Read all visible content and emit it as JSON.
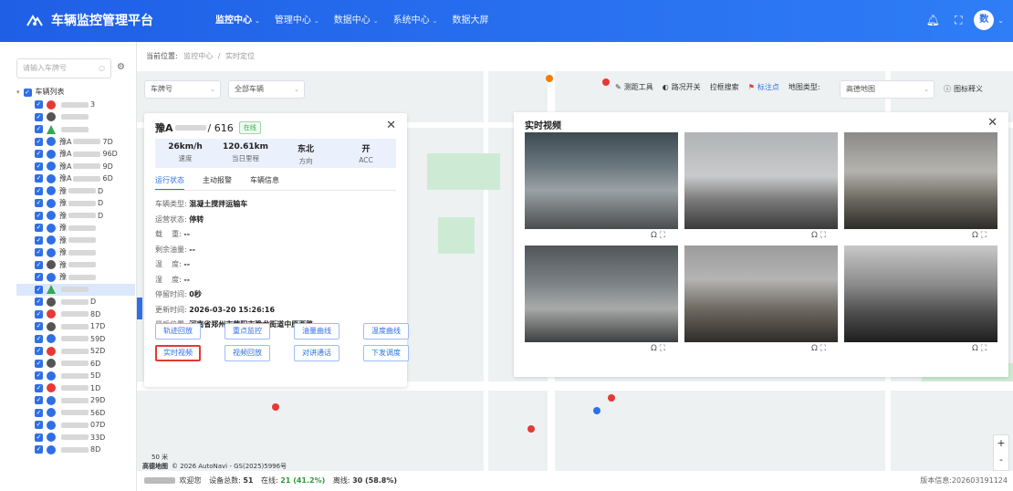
{
  "app": {
    "title": "车辆监控管理平台"
  },
  "nav": [
    {
      "label": "监控中心",
      "caret": "⌄",
      "active": true
    },
    {
      "label": "管理中心",
      "caret": "⌄"
    },
    {
      "label": "数据中心",
      "caret": "⌄"
    },
    {
      "label": "系统中心",
      "caret": "⌄"
    },
    {
      "label": "数据大屏",
      "caret": ""
    }
  ],
  "topright": {
    "avatar": "数",
    "caret": "⌄"
  },
  "colors": {
    "primary": "#2f6fe6",
    "online": "#36a852",
    "offline": "#e53935",
    "highlight": "#e53935"
  },
  "sidebar": {
    "search_placeholder": "请输入车牌号",
    "root_label": "车辆列表",
    "rows": [
      {
        "status": "red",
        "suffix": "3"
      },
      {
        "status": "gray",
        "suffix": ""
      },
      {
        "status": "green-tri",
        "suffix": ""
      },
      {
        "status": "blue",
        "suffix": "7D",
        "plate": "豫A"
      },
      {
        "status": "blue",
        "suffix": "96D",
        "plate": "豫A"
      },
      {
        "status": "blue",
        "suffix": "9D",
        "plate": "豫A"
      },
      {
        "status": "blue",
        "suffix": "6D",
        "plate": "豫A"
      },
      {
        "status": "blue",
        "suffix": "D",
        "plate": "豫"
      },
      {
        "status": "blue",
        "suffix": "D",
        "plate": "豫"
      },
      {
        "status": "blue",
        "suffix": "D",
        "plate": "豫"
      },
      {
        "status": "blue",
        "suffix": "",
        "plate": "豫"
      },
      {
        "status": "blue",
        "suffix": "",
        "plate": "豫"
      },
      {
        "status": "blue",
        "suffix": "",
        "plate": "豫"
      },
      {
        "status": "gray",
        "suffix": "",
        "plate": "豫"
      },
      {
        "status": "blue",
        "suffix": "",
        "plate": "豫"
      },
      {
        "status": "green-tri",
        "suffix": "",
        "plate": "",
        "selected": true
      },
      {
        "status": "gray",
        "suffix": "D",
        "plate": ""
      },
      {
        "status": "red",
        "suffix": "8D",
        "plate": ""
      },
      {
        "status": "gray",
        "suffix": "17D",
        "plate": ""
      },
      {
        "status": "blue",
        "suffix": "59D",
        "plate": ""
      },
      {
        "status": "red",
        "suffix": "52D",
        "plate": ""
      },
      {
        "status": "gray",
        "suffix": "6D",
        "plate": ""
      },
      {
        "status": "blue",
        "suffix": "5D",
        "plate": ""
      },
      {
        "status": "red",
        "suffix": "1D",
        "plate": ""
      },
      {
        "status": "blue",
        "suffix": "29D",
        "plate": ""
      },
      {
        "status": "blue",
        "suffix": "56D",
        "plate": ""
      },
      {
        "status": "blue",
        "suffix": "07D",
        "plate": ""
      },
      {
        "status": "blue",
        "suffix": "33D",
        "plate": ""
      },
      {
        "status": "blue",
        "suffix": "8D",
        "plate": ""
      }
    ]
  },
  "breadcrumb": {
    "label": "当前位置:",
    "items": [
      "监控中心",
      "/",
      "实时定位"
    ]
  },
  "mapbar": {
    "filter1": "车牌号",
    "filter2": "全部车辆",
    "tools": [
      "测距工具",
      "路况开关",
      "拉框搜索",
      "标注点"
    ],
    "maptype_label": "地图类型:",
    "maptype_value": "高德地图",
    "legend": "图标释义"
  },
  "vehicle": {
    "plate_prefix": "豫A",
    "plate_suffix": "/ 616",
    "status": "在线",
    "stats": [
      {
        "value": "26km/h",
        "label": "速度"
      },
      {
        "value": "120.61km",
        "label": "当日里程"
      },
      {
        "value": "东北",
        "label": "方向"
      },
      {
        "value": "开",
        "label": "ACC"
      }
    ],
    "tabs": [
      "运行状态",
      "主动报警",
      "车辆信息"
    ],
    "info": [
      {
        "k": "车辆类型:",
        "v": "混凝土搅拌运输车"
      },
      {
        "k": "运营状态:",
        "v": "停转"
      },
      {
        "k": "载    重:",
        "v": "--"
      },
      {
        "k": "剩余油量:",
        "v": "--"
      },
      {
        "k": "温    度:",
        "v": "--"
      },
      {
        "k": "湿    度:",
        "v": "--"
      },
      {
        "k": "停留时间:",
        "v": "0秒"
      },
      {
        "k": "更新时间:",
        "v": "2026-03-20 15:26:16"
      },
      {
        "k": "最后位置:",
        "v": "河南省郑州市荥阳市豫龙街道中原西路"
      }
    ],
    "buttons": [
      "轨迹回放",
      "重点监控",
      "油量曲线",
      "温度曲线",
      "实时视频",
      "视频回放",
      "对讲通话",
      "下发调度"
    ]
  },
  "video": {
    "title": "实时视频",
    "cam_ctrl": "Ω ⛶"
  },
  "footer": {
    "welcome": "欢迎您",
    "total_label": "设备总数:",
    "total": "51",
    "online_label": "在线:",
    "online": "21 (41.2%)",
    "offline_label": "离线:",
    "offline": "30 (58.8%)",
    "version": "版本信息:202603191124"
  },
  "map": {
    "scale": "50 米",
    "provider": "高德地图",
    "copyright": "© 2026 AutoNavi - GS(2025)5996号"
  }
}
